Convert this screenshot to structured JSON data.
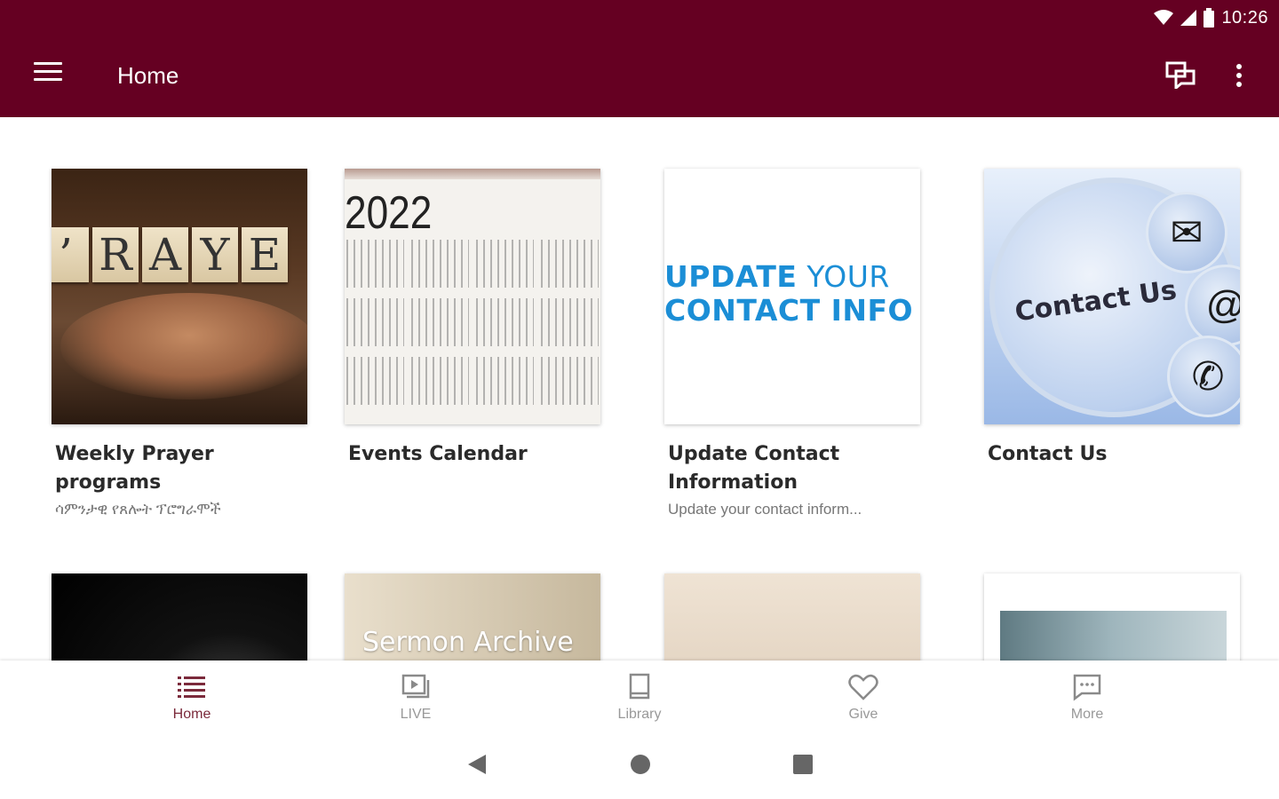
{
  "status": {
    "time": "10:26"
  },
  "appbar": {
    "title": "Home",
    "background": "#650022"
  },
  "cards": [
    {
      "title": "Weekly Prayer programs",
      "subtitle": "ሳምንታዊ የጸሎት ፕሮግራሞች",
      "tile_letters": [
        "R",
        "A",
        "Y",
        "E"
      ]
    },
    {
      "title": "Events Calendar",
      "year": "2022"
    },
    {
      "title": "Update Contact Information",
      "subtitle": "Update your contact inform...",
      "graphic_line1_bold": "UPDATE",
      "graphic_line1_light": " YOUR",
      "graphic_line2": "CONTACT INFO"
    },
    {
      "title": "Contact Us",
      "graphic_text": "Contact Us"
    }
  ],
  "row2": {
    "sermon_text": "Sermon Archive"
  },
  "bottom_nav": {
    "items": [
      {
        "label": "Home",
        "icon": "list-icon",
        "active": true
      },
      {
        "label": "LIVE",
        "icon": "video-icon",
        "active": false
      },
      {
        "label": "Library",
        "icon": "book-icon",
        "active": false
      },
      {
        "label": "Give",
        "icon": "heart-icon",
        "active": false
      },
      {
        "label": "More",
        "icon": "chat-bubble-icon",
        "active": false
      }
    ],
    "active_color": "#7b2a3b"
  }
}
